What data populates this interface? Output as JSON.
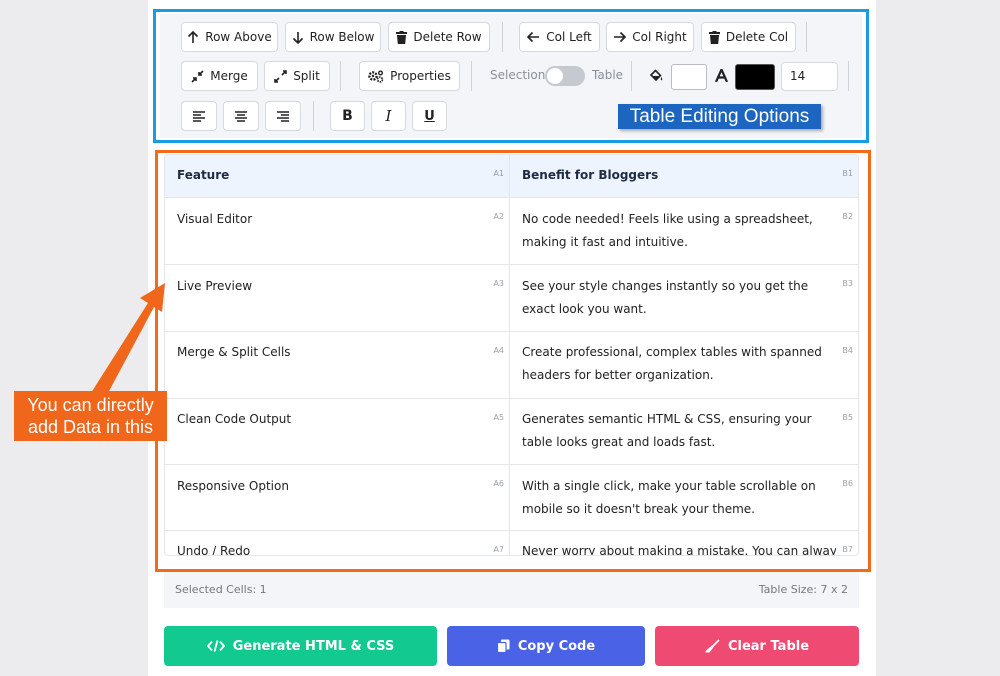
{
  "toolbar": {
    "row_above": "Row Above",
    "row_below": "Row Below",
    "delete_row": "Delete Row",
    "col_left": "Col Left",
    "col_right": "Col Right",
    "delete_col": "Delete Col",
    "merge": "Merge",
    "split": "Split",
    "properties": "Properties",
    "selection_label": "Selection",
    "table_label": "Table",
    "background_color": "#ffffff",
    "text_color": "#000000",
    "font_size": "14",
    "bold": "B",
    "italic": "I",
    "underline": "U",
    "callout": "Table Editing Options"
  },
  "table": {
    "rows": [
      {
        "a": "Feature",
        "b": "Benefit for Bloggers",
        "a_ref": "A1",
        "b_ref": "B1"
      },
      {
        "a": "Visual Editor",
        "b": "No code needed! Feels like using a spreadsheet, making it fast and intuitive.",
        "a_ref": "A2",
        "b_ref": "B2"
      },
      {
        "a": "Live Preview",
        "b": "See your style changes instantly so you get the exact look you want.",
        "a_ref": "A3",
        "b_ref": "B3"
      },
      {
        "a": "Merge & Split Cells",
        "b": "Create professional, complex tables with spanned headers for better organization.",
        "a_ref": "A4",
        "b_ref": "B4"
      },
      {
        "a": "Clean Code Output",
        "b": "Generates semantic HTML & CSS, ensuring your table looks great and loads fast.",
        "a_ref": "A5",
        "b_ref": "B5"
      },
      {
        "a": "Responsive Option",
        "b": "With a single click, make your table scrollable on mobile so it doesn't break your theme.",
        "a_ref": "A6",
        "b_ref": "B6"
      },
      {
        "a": "Undo / Redo",
        "b": "Never worry about making a mistake. You can always go",
        "a_ref": "A7",
        "b_ref": "B7"
      }
    ],
    "callout": "You can directly add Data in this"
  },
  "status": {
    "selected": "Selected Cells: 1",
    "size": "Table Size: 7 x 2"
  },
  "actions": {
    "generate": "Generate HTML & CSS",
    "copy": "Copy Code",
    "clear": "Clear Table",
    "generate_color": "#12c990",
    "copy_color": "#4a63e6",
    "clear_color": "#ef4a72"
  },
  "icons": [
    "arrow-up-icon",
    "arrow-down-icon",
    "trash-icon",
    "arrow-left-icon",
    "arrow-right-icon",
    "compress-icon",
    "expand-icon",
    "gears-icon",
    "paint-bucket-icon",
    "font-color-icon",
    "align-left-icon",
    "align-center-icon",
    "align-right-icon",
    "code-icon",
    "copy-icon",
    "broom-icon"
  ]
}
